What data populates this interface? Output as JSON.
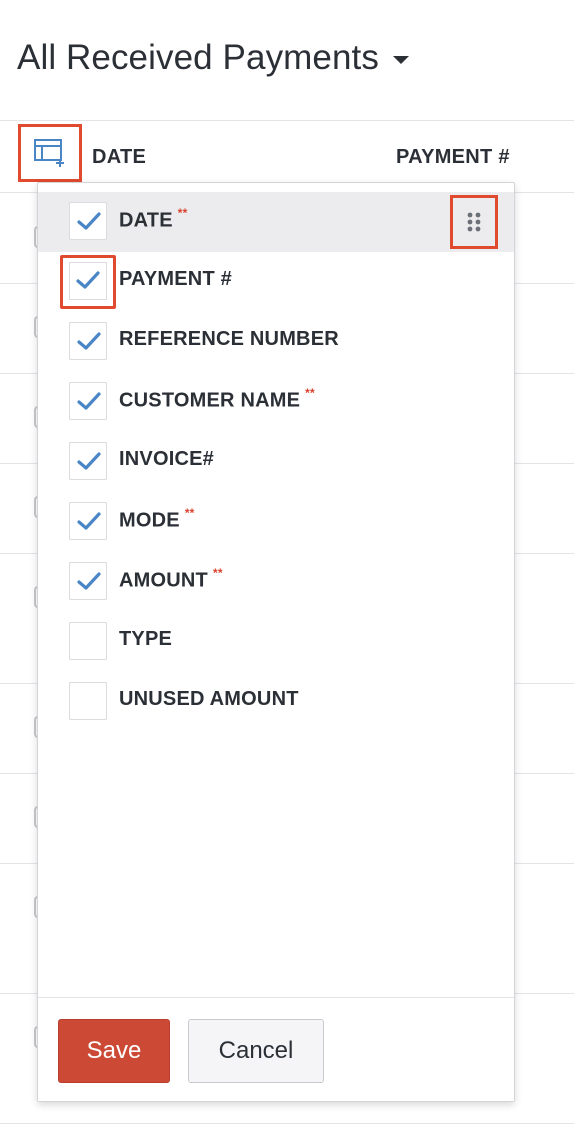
{
  "header": {
    "title": "All Received Payments"
  },
  "table": {
    "columns": [
      "DATE",
      "PAYMENT #"
    ]
  },
  "column_picker": {
    "items": [
      {
        "label": "DATE",
        "checked": true,
        "mandatory": "**"
      },
      {
        "label": "PAYMENT #",
        "checked": true,
        "mandatory": ""
      },
      {
        "label": "REFERENCE NUMBER",
        "checked": true,
        "mandatory": ""
      },
      {
        "label": "CUSTOMER NAME",
        "checked": true,
        "mandatory": "**"
      },
      {
        "label": "INVOICE#",
        "checked": true,
        "mandatory": ""
      },
      {
        "label": "MODE",
        "checked": true,
        "mandatory": "**"
      },
      {
        "label": "AMOUNT",
        "checked": true,
        "mandatory": "**"
      },
      {
        "label": "TYPE",
        "checked": false,
        "mandatory": ""
      },
      {
        "label": "UNUSED AMOUNT",
        "checked": false,
        "mandatory": ""
      }
    ],
    "save_label": "Save",
    "cancel_label": "Cancel"
  },
  "colors": {
    "accent": "#4a86c5",
    "highlight": "#e04a2f",
    "save_button": "#cc4a35",
    "mandatory_marker": "#d9412b"
  },
  "icons": {
    "customize": "table-columns-icon",
    "drag": "drag-handle-icon",
    "check": "check-icon",
    "title_dropdown": "caret-down-icon"
  }
}
